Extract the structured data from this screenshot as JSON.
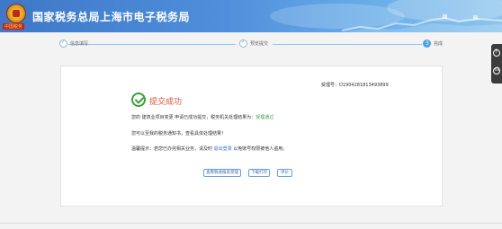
{
  "header": {
    "site_title": "国家税务总局上海市电子税务局",
    "emblem_label": "中国税务"
  },
  "stepper": {
    "steps": [
      {
        "label": "信息填写",
        "state": "done"
      },
      {
        "label": "预览提交",
        "state": "done"
      },
      {
        "label": "完成",
        "state": "current",
        "number": "3"
      }
    ]
  },
  "result": {
    "accept_no": "受理号：D1904281813493899",
    "title": "提交成功",
    "line1_prefix": "您的 建筑业项目变更 申请已成功提交，税务机关处理结果为：",
    "line1_status": "受理通过",
    "line2": "您可以至我的税务通知书，查看具体处理结果！",
    "line3_prefix": "温馨提示：若您已办完相关业务，请及时",
    "line3_link": "退出登录",
    "line3_suffix": "以免账号权限被他人盗用。"
  },
  "buttons": {
    "view_doc": "查看税收报表受理",
    "download_print": "下载打印",
    "evaluate": "评价"
  },
  "side_tools": {
    "help_icon": "question-icon",
    "service_icon": "headset-icon"
  }
}
